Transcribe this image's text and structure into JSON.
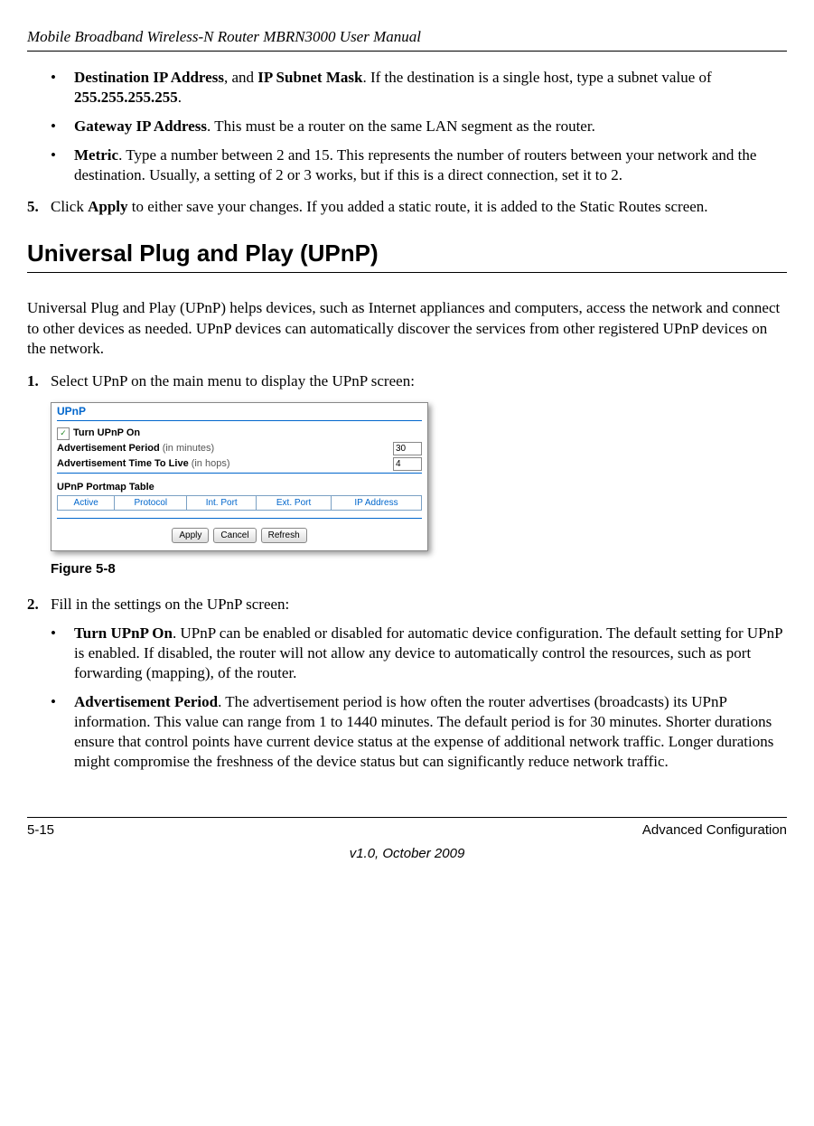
{
  "header": {
    "title": "Mobile Broadband Wireless-N Router MBRN3000 User Manual"
  },
  "bullets_top": [
    {
      "html": "<b>Destination IP Address</b>, and <b>IP Subnet Mask</b>. If the destination is a single host, type a subnet value of <b>255.255.255.255</b>."
    },
    {
      "html": "<b>Gateway IP Address</b>. This must be a router on the same LAN segment as the router."
    },
    {
      "html": "<b>Metric</b>. Type a number between 2 and 15. This represents the number of routers between your network and the destination. Usually, a setting of 2 or 3 works, but if this is a direct connection, set it to 2."
    }
  ],
  "step5": {
    "num": "5.",
    "html": "Click <b>Apply</b> to either save your changes. If you added a static route, it is added to the Static Routes screen."
  },
  "section": {
    "heading": "Universal Plug and Play (UPnP)",
    "intro": "Universal Plug and Play (UPnP) helps devices, such as Internet appliances and computers, access the network and connect to other devices as needed. UPnP devices can automatically discover the services from other registered UPnP devices on the network."
  },
  "step1": {
    "num": "1.",
    "text": "Select UPnP on the main menu to display the UPnP screen:"
  },
  "upnp_panel": {
    "title": "UPnP",
    "turn_on_label": "Turn UPnP On",
    "check_mark": "✓",
    "adv_period_bold": "Advertisement Period",
    "adv_period_reg": "(in minutes)",
    "adv_period_val": "30",
    "adv_ttl_bold": "Advertisement Time To Live",
    "adv_ttl_reg": "(in hops)",
    "adv_ttl_val": "4",
    "portmap_label": "UPnP Portmap Table",
    "cols": [
      "Active",
      "Protocol",
      "Int. Port",
      "Ext. Port",
      "IP Address"
    ],
    "btn_apply": "Apply",
    "btn_cancel": "Cancel",
    "btn_refresh": "Refresh"
  },
  "figure_caption": "Figure 5-8",
  "step2": {
    "num": "2.",
    "text": "Fill in the settings on the UPnP screen:",
    "subs": [
      {
        "html": "<b>Turn UPnP On</b>. UPnP can be enabled or disabled for automatic device configuration. The default setting for UPnP is enabled. If disabled, the router will not allow any device to automatically control the resources, such as port forwarding (mapping), of the router."
      },
      {
        "html": "<b>Advertisement Period</b>. The advertisement period is how often the router advertises (broadcasts) its UPnP information. This value can range from 1 to 1440 minutes. The default period is for 30 minutes. Shorter durations ensure that control points have current device status at the expense of additional network traffic. Longer durations might compromise the freshness of the device status but can significantly reduce network traffic."
      }
    ]
  },
  "footer": {
    "page": "5-15",
    "section": "Advanced Configuration",
    "version": "v1.0, October 2009"
  }
}
